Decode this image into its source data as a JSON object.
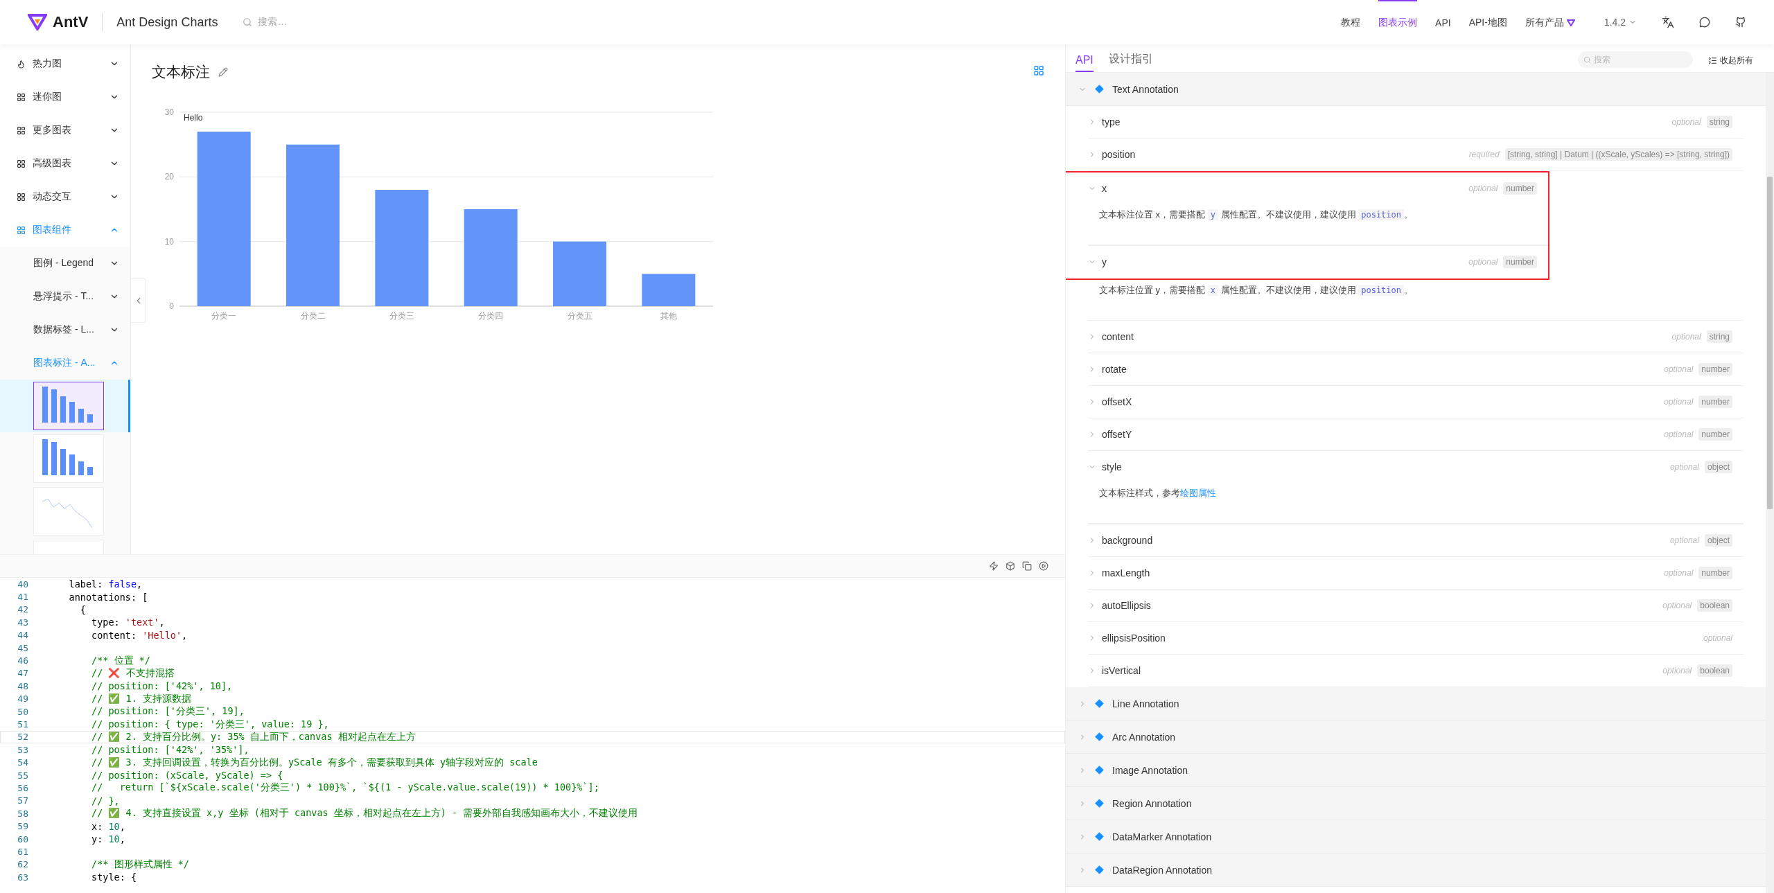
{
  "header": {
    "logo": "AntV",
    "product": "Ant Design Charts",
    "search_placeholder": "搜索…",
    "nav": [
      {
        "label": "教程",
        "selected": false
      },
      {
        "label": "图表示例",
        "selected": true
      },
      {
        "label": "API",
        "selected": false
      },
      {
        "label": "API-地图",
        "selected": false
      },
      {
        "label": "所有产品",
        "selected": false
      }
    ],
    "version": "1.4.2"
  },
  "sidebar": {
    "items": [
      {
        "label": "热力图",
        "kind": "heat",
        "expanded": false,
        "selected": false
      },
      {
        "label": "迷你图",
        "kind": "grid",
        "expanded": false,
        "selected": false
      },
      {
        "label": "更多图表",
        "kind": "grid",
        "expanded": false,
        "selected": false
      },
      {
        "label": "高级图表",
        "kind": "grid",
        "expanded": false,
        "selected": false
      },
      {
        "label": "动态交互",
        "kind": "grid",
        "expanded": false,
        "selected": false
      },
      {
        "label": "图表组件",
        "kind": "grid",
        "expanded": true,
        "selected": true,
        "children": [
          {
            "label": "图例 - Legend",
            "expanded": false,
            "selected": false
          },
          {
            "label": "悬浮提示 - T...",
            "expanded": false,
            "selected": false
          },
          {
            "label": "数据标签 - L...",
            "expanded": false,
            "selected": false
          },
          {
            "label": "图表标注 - A...",
            "expanded": true,
            "selected": true
          }
        ]
      }
    ],
    "thumbnails": [
      {
        "kind": "bars",
        "selected": true
      },
      {
        "kind": "bars",
        "selected": false
      },
      {
        "kind": "line",
        "selected": false
      },
      {
        "kind": "blank",
        "selected": false
      }
    ]
  },
  "demo": {
    "title": "文本标注",
    "annotation": "Hello",
    "chart_data": {
      "type": "bar",
      "categories": [
        "分类一",
        "分类二",
        "分类三",
        "分类四",
        "分类五",
        "其他"
      ],
      "values": [
        27,
        25,
        18,
        15,
        10,
        5
      ],
      "ylim": [
        0,
        30
      ],
      "yticks": [
        0,
        10,
        20,
        30
      ]
    }
  },
  "editor": {
    "lines": [
      {
        "n": "40",
        "active": false,
        "segs": [
          {
            "t": "    label: ",
            "kind": "plain"
          },
          {
            "t": "false",
            "kind": "keyword"
          },
          {
            "t": ",",
            "kind": "plain"
          }
        ]
      },
      {
        "n": "41",
        "active": false,
        "segs": [
          {
            "t": "    annotations: [",
            "kind": "plain"
          }
        ]
      },
      {
        "n": "42",
        "active": false,
        "segs": [
          {
            "t": "      {",
            "kind": "plain"
          }
        ]
      },
      {
        "n": "43",
        "active": false,
        "segs": [
          {
            "t": "        type: ",
            "kind": "plain"
          },
          {
            "t": "'text'",
            "kind": "string"
          },
          {
            "t": ",",
            "kind": "plain"
          }
        ]
      },
      {
        "n": "44",
        "active": false,
        "segs": [
          {
            "t": "        content: ",
            "kind": "plain"
          },
          {
            "t": "'Hello'",
            "kind": "string"
          },
          {
            "t": ",",
            "kind": "plain"
          }
        ]
      },
      {
        "n": "45",
        "active": false
      },
      {
        "n": "46",
        "active": false,
        "segs": [
          {
            "t": "        /** 位置 */",
            "kind": "comment"
          }
        ]
      },
      {
        "n": "47",
        "active": false,
        "segs": [
          {
            "t": "        // ❌ 不支持混搭",
            "kind": "comment"
          }
        ]
      },
      {
        "n": "48",
        "active": false,
        "segs": [
          {
            "t": "        // position: ['42%', 10],",
            "kind": "comment"
          }
        ]
      },
      {
        "n": "49",
        "active": false,
        "segs": [
          {
            "t": "        // ✅ 1. 支持源数据",
            "kind": "comment"
          }
        ]
      },
      {
        "n": "50",
        "active": false,
        "segs": [
          {
            "t": "        // position: ['分类三', 19],",
            "kind": "comment"
          }
        ]
      },
      {
        "n": "51",
        "active": false,
        "segs": [
          {
            "t": "        // position: { type: '分类三', value: 19 },",
            "kind": "comment"
          }
        ]
      },
      {
        "n": "52",
        "active": true,
        "segs": [
          {
            "t": "        // ✅ 2. 支持百分比例。y: 35% 自上而下，canvas 相对起点在左上方",
            "kind": "comment"
          }
        ]
      },
      {
        "n": "53",
        "active": false,
        "segs": [
          {
            "t": "        // position: ['42%', '35%'],",
            "kind": "comment"
          }
        ]
      },
      {
        "n": "54",
        "active": false,
        "segs": [
          {
            "t": "        // ✅ 3. 支持回调设置，转换为百分比例。yScale 有多个，需要获取到具体 y轴字段对应的 scale",
            "kind": "comment"
          }
        ]
      },
      {
        "n": "55",
        "active": false,
        "segs": [
          {
            "t": "        // position: (xScale, yScale) => {",
            "kind": "comment"
          }
        ]
      },
      {
        "n": "56",
        "active": false,
        "segs": [
          {
            "t": "        //   return [`${xScale.scale('分类三') * 100}%`, `${(1 - yScale.value.scale(19)) * 100}%`];",
            "kind": "comment"
          }
        ]
      },
      {
        "n": "57",
        "active": false,
        "segs": [
          {
            "t": "        // },",
            "kind": "comment"
          }
        ]
      },
      {
        "n": "58",
        "active": false,
        "segs": [
          {
            "t": "        // ✅ 4. 支持直接设置 x,y 坐标 (相对于 canvas 坐标，相对起点在左上方) - 需要外部自我感知画布大小，不建议使用",
            "kind": "comment"
          }
        ]
      },
      {
        "n": "59",
        "active": false,
        "segs": [
          {
            "t": "        x: ",
            "kind": "plain"
          },
          {
            "t": "10",
            "kind": "number"
          },
          {
            "t": ",",
            "kind": "plain"
          }
        ]
      },
      {
        "n": "60",
        "active": false,
        "segs": [
          {
            "t": "        y: ",
            "kind": "plain"
          },
          {
            "t": "10",
            "kind": "number"
          },
          {
            "t": ",",
            "kind": "plain"
          }
        ]
      },
      {
        "n": "61",
        "active": false
      },
      {
        "n": "62",
        "active": false,
        "segs": [
          {
            "t": "        /** 图形样式属性 */",
            "kind": "comment"
          }
        ]
      },
      {
        "n": "63",
        "active": false,
        "segs": [
          {
            "t": "        style: {",
            "kind": "plain"
          }
        ]
      }
    ]
  },
  "api": {
    "tabs": [
      {
        "label": "API",
        "selected": true
      },
      {
        "label": "设计指引",
        "selected": false
      }
    ],
    "search_placeholder": "搜索",
    "collapse_all": "收起所有",
    "sections": [
      {
        "title": "Text Annotation",
        "expanded": true,
        "props": [
          {
            "name": "type",
            "req": "optional",
            "type": "string",
            "expanded": false,
            "highlighted": false
          },
          {
            "name": "position",
            "req": "required",
            "type": "[string, string] | Datum | ((xScale, yScales) => [string, string])",
            "expanded": false,
            "highlighted": false
          },
          {
            "name": "x",
            "req": "optional",
            "type": "number",
            "expanded": true,
            "highlighted": true,
            "desc": [
              {
                "t": "文本标注位置 x，需要搭配 ",
                "kind": "text"
              },
              {
                "t": "y",
                "kind": "code"
              },
              {
                "t": " 属性配置。不建议使用，建议使用 ",
                "kind": "text"
              },
              {
                "t": "position",
                "kind": "code"
              },
              {
                "t": "。",
                "kind": "text"
              }
            ]
          },
          {
            "name": "y",
            "req": "optional",
            "type": "number",
            "expanded": true,
            "highlighted": true,
            "desc": [
              {
                "t": "文本标注位置 y，需要搭配 ",
                "kind": "text"
              },
              {
                "t": "x",
                "kind": "code"
              },
              {
                "t": " 属性配置。不建议使用，建议使用 ",
                "kind": "text"
              },
              {
                "t": "position",
                "kind": "code"
              },
              {
                "t": "。",
                "kind": "text"
              }
            ]
          },
          {
            "name": "content",
            "req": "optional",
            "type": "string",
            "expanded": false,
            "highlighted": false
          },
          {
            "name": "rotate",
            "req": "optional",
            "type": "number",
            "expanded": false,
            "highlighted": false
          },
          {
            "name": "offsetX",
            "req": "optional",
            "type": "number",
            "expanded": false,
            "highlighted": false
          },
          {
            "name": "offsetY",
            "req": "optional",
            "type": "number",
            "expanded": false,
            "highlighted": false
          },
          {
            "name": "style",
            "req": "optional",
            "type": "object",
            "expanded": true,
            "highlighted": false,
            "desc": [
              {
                "t": "文本标注样式，参考",
                "kind": "text"
              },
              {
                "t": "绘图属性",
                "kind": "link"
              }
            ]
          },
          {
            "name": "background",
            "req": "optional",
            "type": "object",
            "expanded": false,
            "highlighted": false
          },
          {
            "name": "maxLength",
            "req": "optional",
            "type": "number",
            "expanded": false,
            "highlighted": false
          },
          {
            "name": "autoEllipsis",
            "req": "optional",
            "type": "boolean",
            "expanded": false,
            "highlighted": false
          },
          {
            "name": "ellipsisPosition",
            "req": "optional",
            "expanded": false,
            "highlighted": false
          },
          {
            "name": "isVertical",
            "req": "optional",
            "type": "boolean",
            "expanded": false,
            "highlighted": false
          }
        ]
      },
      {
        "title": "Line Annotation",
        "expanded": false
      },
      {
        "title": "Arc Annotation",
        "expanded": false
      },
      {
        "title": "Image Annotation",
        "expanded": false
      },
      {
        "title": "Region Annotation",
        "expanded": false
      },
      {
        "title": "DataMarker Annotation",
        "expanded": false
      },
      {
        "title": "DataRegion Annotation",
        "expanded": false
      }
    ]
  }
}
